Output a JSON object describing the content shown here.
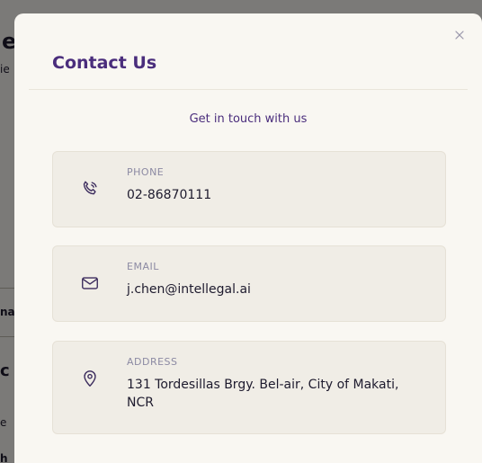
{
  "modal": {
    "title": "Contact Us",
    "subtitle": "Get in touch with us"
  },
  "contacts": [
    {
      "label": "PHONE",
      "value": "02-86870111",
      "icon": "phone-icon"
    },
    {
      "label": "EMAIL",
      "value": "j.chen@intellegal.ai",
      "icon": "mail-icon"
    },
    {
      "label": "ADDRESS",
      "value": "131 Tordesillas Brgy. Bel-air, City of Makati, NCR",
      "icon": "location-pin-icon"
    }
  ],
  "background_fragments": [
    "e",
    "ie",
    "na",
    "c",
    "e",
    "h"
  ],
  "colors": {
    "accent": "#4a2d7c",
    "modal_bg": "#f9f7f2",
    "card_bg": "#f0ede6",
    "label": "#8c8aa3",
    "overlay": "rgba(0,0,0,0.5)"
  }
}
